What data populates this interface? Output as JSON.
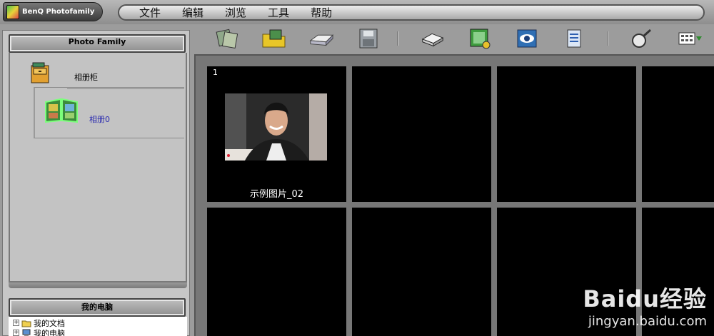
{
  "app": {
    "title": "BenQ Photofamily"
  },
  "menu": [
    {
      "label": "文件"
    },
    {
      "label": "编辑"
    },
    {
      "label": "浏览"
    },
    {
      "label": "工具"
    },
    {
      "label": "帮助"
    }
  ],
  "toolbar": {
    "buttons": [
      {
        "icon": "import-photos-icon"
      },
      {
        "icon": "open-folder-icon"
      },
      {
        "icon": "scanner-icon"
      },
      {
        "icon": "save-disk-icon"
      },
      {
        "icon": "eraser-icon"
      },
      {
        "icon": "edit-photo-icon"
      },
      {
        "icon": "view-eye-icon"
      },
      {
        "icon": "document-icon"
      },
      {
        "icon": "magnifier-icon"
      },
      {
        "icon": "thumbnail-view-icon"
      }
    ]
  },
  "left_panel": {
    "title": "Photo Family",
    "cabinet_label": "相册柜",
    "album_label": "相册0"
  },
  "computer_panel": {
    "title": "我的电脑",
    "items": [
      {
        "label": "我的文档"
      },
      {
        "label": "我的电脑"
      }
    ]
  },
  "grid": {
    "cells": [
      {
        "number": "1",
        "caption": "示例图片_02"
      }
    ]
  },
  "watermark": {
    "logo": "Baidu经验",
    "url": "jingyan.baidu.com"
  }
}
